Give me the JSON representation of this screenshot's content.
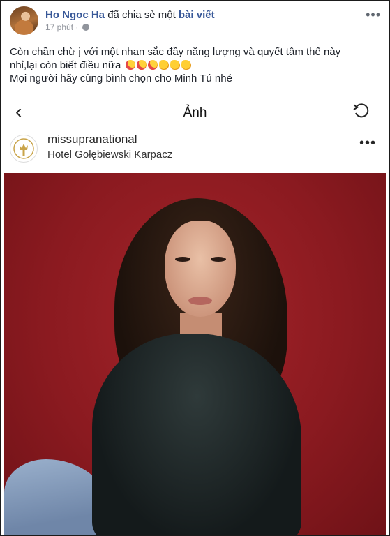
{
  "post": {
    "author": "Ho Ngoc Ha",
    "action": "đã chia sẻ một",
    "object_link": "bài viết",
    "time": "17 phút",
    "more_label": "•••",
    "line1": "Còn chần chừ j với một nhan sắc đầy năng lượng và quyết tâm thế này",
    "line2": "nhỉ,lại còn biết điều nữa",
    "line3": "Mọi người hãy cùng bình chọn cho Minh Tú nhé"
  },
  "shared_view": {
    "back_glyph": "‹",
    "title": "Ảnh",
    "username": "missupranational",
    "location": "Hotel Gołębiewski Karpacz",
    "more_label": "•••"
  },
  "icons": [
    "globe-icon",
    "kiss-emoji-icon",
    "clap-emoji-icon",
    "back-chevron-icon",
    "refresh-icon",
    "more-icon"
  ],
  "colors": {
    "link": "#385898",
    "photo_background": "#8b1a20"
  }
}
